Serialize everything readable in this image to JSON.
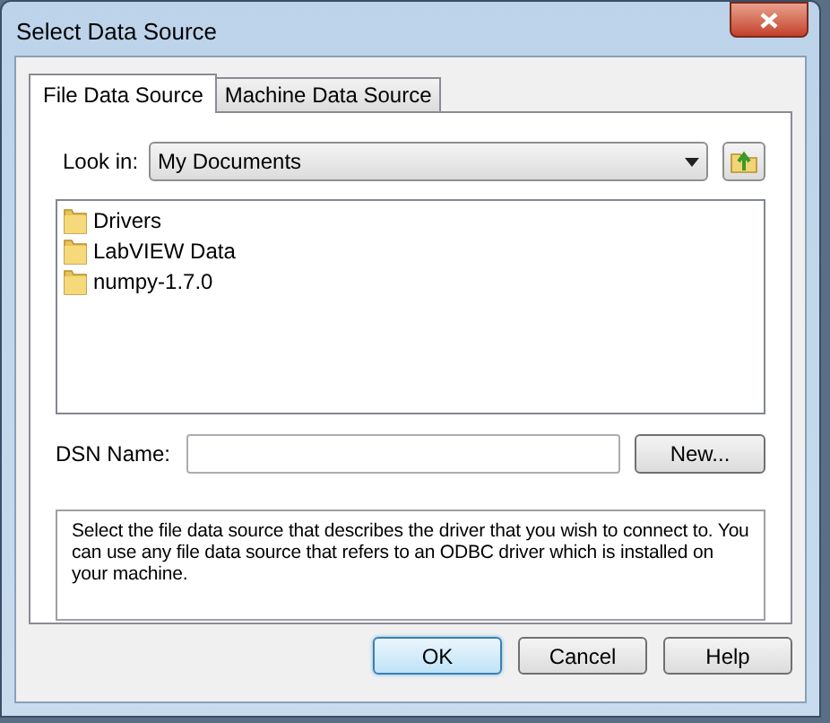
{
  "window": {
    "title": "Select Data Source"
  },
  "tabs": [
    {
      "label": "File Data Source",
      "selected": true
    },
    {
      "label": "Machine Data Source",
      "selected": false
    }
  ],
  "look_in": {
    "label": "Look in:",
    "value": "My Documents"
  },
  "files": [
    {
      "name": "Drivers"
    },
    {
      "name": "LabVIEW Data"
    },
    {
      "name": "numpy-1.7.0"
    }
  ],
  "dsn": {
    "label": "DSN Name:",
    "new_button": "New..."
  },
  "description": "Select the file data source that describes the driver that you wish to connect to. You can use any file data source that refers to an ODBC driver which is installed on your machine.",
  "buttons": [
    {
      "label": "OK",
      "default": true
    },
    {
      "label": "Cancel",
      "default": false
    },
    {
      "label": "Help",
      "default": false
    }
  ]
}
